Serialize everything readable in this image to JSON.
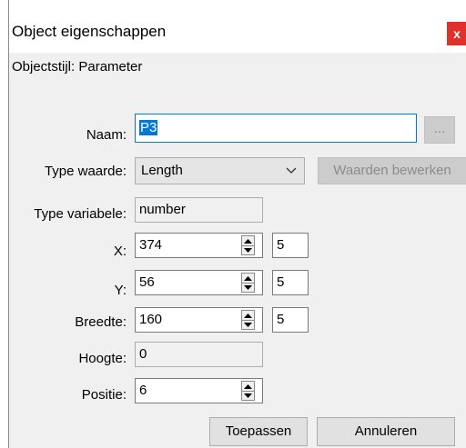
{
  "dialog": {
    "title": "Object eigenschappen",
    "close_label": "x",
    "subtitle": "Objectstijl: Parameter"
  },
  "form": {
    "naam": {
      "label": "Naam:",
      "value": "P3",
      "browse_label": "..."
    },
    "type_waarde": {
      "label": "Type waarde:",
      "value": "Length",
      "edit_button": "Waarden bewerken"
    },
    "type_variabele": {
      "label": "Type variabele:",
      "value": "number"
    },
    "x": {
      "label": "X:",
      "value": "374",
      "step": "5"
    },
    "y": {
      "label": "Y:",
      "value": "56",
      "step": "5"
    },
    "breedte": {
      "label": "Breedte:",
      "value": "160",
      "step": "5"
    },
    "hoogte": {
      "label": "Hoogte:",
      "value": "0"
    },
    "positie": {
      "label": "Positie:",
      "value": "6"
    }
  },
  "buttons": {
    "apply": "Toepassen",
    "cancel": "Annuleren"
  },
  "colors": {
    "dialog_bg": "#f0f0f0",
    "accent": "#0078d7",
    "close_red": "#e0312a"
  }
}
